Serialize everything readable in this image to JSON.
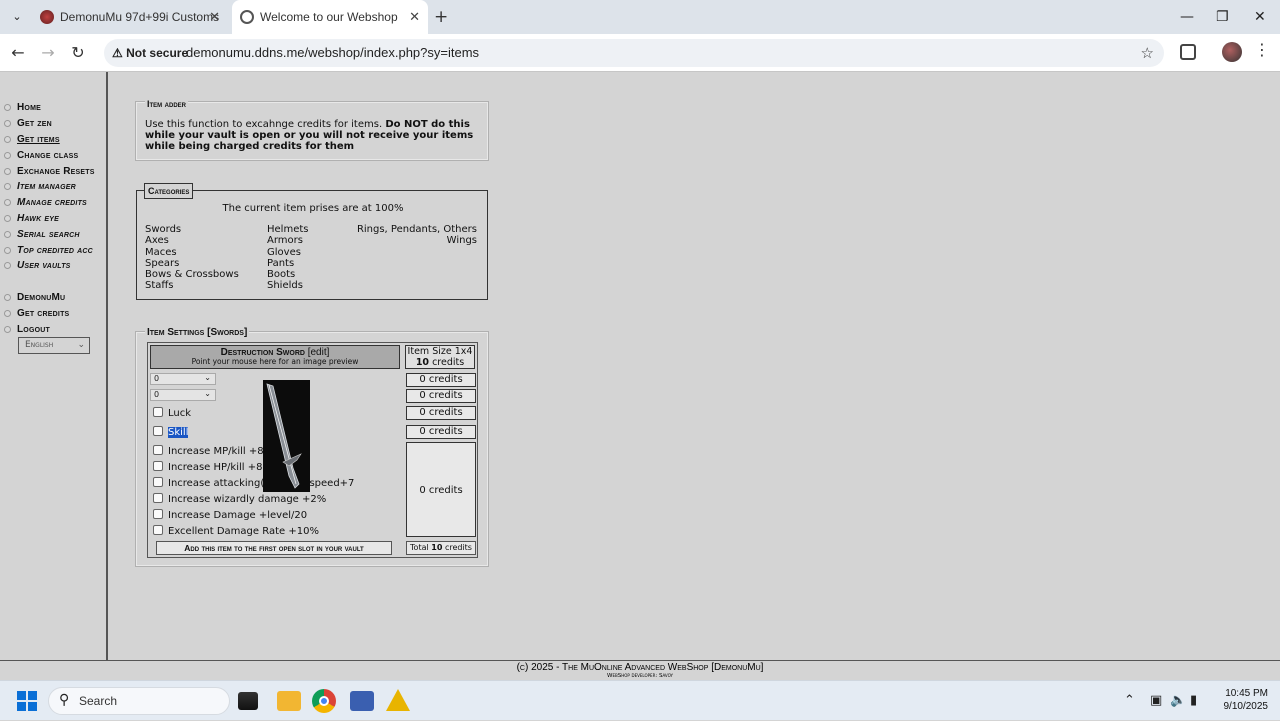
{
  "browser": {
    "tabs": [
      {
        "title": "DemonuMu 97d+99i Customs"
      },
      {
        "title": "Welcome to our Webshop"
      }
    ],
    "security_label": "Not secure",
    "url": "demonumu.ddns.me/webshop/index.php?sy=items"
  },
  "sidebar": {
    "items": [
      {
        "label": "Home"
      },
      {
        "label": "Get zen"
      },
      {
        "label": "Get items"
      },
      {
        "label": "Change class"
      },
      {
        "label": "Exchange Resets"
      },
      {
        "label": "Item manager"
      },
      {
        "label": "Manage credits"
      },
      {
        "label": "Hawk eye"
      },
      {
        "label": "Serial search"
      },
      {
        "label": "Top credited acc"
      },
      {
        "label": "User vaults"
      }
    ],
    "secondary": [
      {
        "label": "DemonuMu"
      },
      {
        "label": "Get credits"
      },
      {
        "label": "Logout"
      }
    ],
    "language": "English"
  },
  "item_adder": {
    "heading": "Item adder",
    "text_plain": "Use this function to excahnge credits for items. ",
    "text_bold": "Do NOT do this while your vault is open or you will not receive your items while being charged credits for them"
  },
  "categories": {
    "heading": "Categories",
    "price_note": "The current item prises are at 100%",
    "col1": [
      "Swords",
      "Axes",
      "Maces",
      "Spears",
      "Bows & Crossbows",
      "Staffs"
    ],
    "col2": [
      "Helmets",
      "Armors",
      "Gloves",
      "Pants",
      "Boots",
      "Shields"
    ],
    "col3": [
      "Rings, Pendants, Others",
      "Wings"
    ]
  },
  "item_settings": {
    "heading": "Item Settings [Swords]",
    "item_name": "Destruction Sword",
    "edit_label": "[edit]",
    "preview_hint": "Point your mouse here for an image preview",
    "item_size_label": "Item Size 1x4",
    "base_credits": "10",
    "credits_word": "credits",
    "dropdown1_value": "0",
    "dropdown2_value": "0",
    "luck_label": "Luck",
    "skill_label": "Skill",
    "options": [
      "Increase MP/kill +8",
      "Increase HP/kill +8",
      "Increase attacking(wizardly)speed+7",
      "Increase wizardly damage +2%",
      "Increase Damage +level/20",
      "Excellent Damage Rate +10%"
    ],
    "credit_cells": [
      "0 credits",
      "0 credits",
      "0 credits",
      "0 credits"
    ],
    "options_credits": "0 credits",
    "add_button": "Add this item to the first open slot in your vault",
    "total_label": "Total",
    "total_value": "10"
  },
  "footer": {
    "line1": "(c) 2025 - The MuOnline Advanced WebShop [DemonuMu]",
    "line2": "WebShop developer: Savoy"
  },
  "taskbar": {
    "search_placeholder": "Search",
    "time": "10:45 PM",
    "date": "9/10/2025"
  },
  "colors": {
    "page_bg": "#d4d4d4",
    "selection": "#1a56c4",
    "win_accent": "#0a6fd6"
  }
}
